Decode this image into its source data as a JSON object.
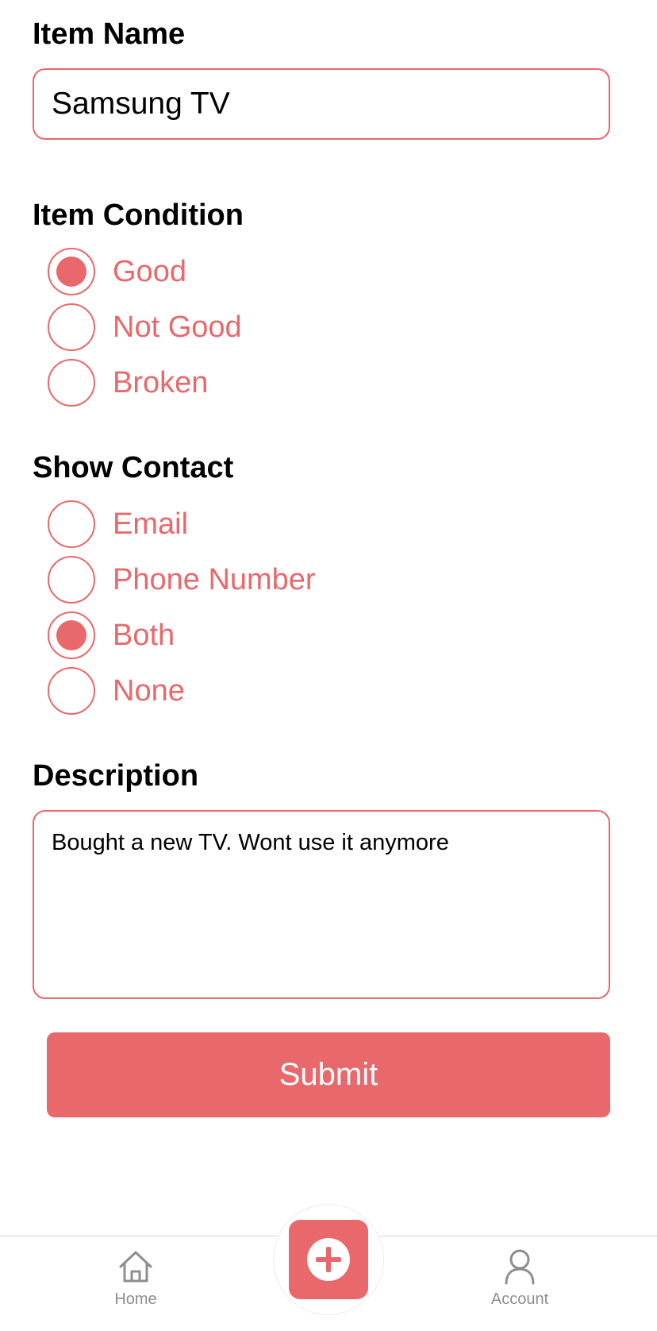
{
  "form": {
    "item_name": {
      "label": "Item Name",
      "value": "Samsung TV"
    },
    "item_condition": {
      "label": "Item Condition",
      "options": [
        {
          "label": "Good",
          "selected": true
        },
        {
          "label": "Not Good",
          "selected": false
        },
        {
          "label": "Broken",
          "selected": false
        }
      ]
    },
    "show_contact": {
      "label": "Show Contact",
      "options": [
        {
          "label": "Email",
          "selected": false
        },
        {
          "label": "Phone Number",
          "selected": false
        },
        {
          "label": "Both",
          "selected": true
        },
        {
          "label": "None",
          "selected": false
        }
      ]
    },
    "description": {
      "label": "Description",
      "value": "Bought a new TV. Wont use it anymore"
    },
    "submit_label": "Submit"
  },
  "tabbar": {
    "home_label": "Home",
    "account_label": "Account",
    "home_icon": "home-icon",
    "add_icon": "plus-circle-icon",
    "account_icon": "person-icon"
  },
  "colors": {
    "accent": "#e9686b",
    "tab_inactive": "#8e8e8e"
  }
}
